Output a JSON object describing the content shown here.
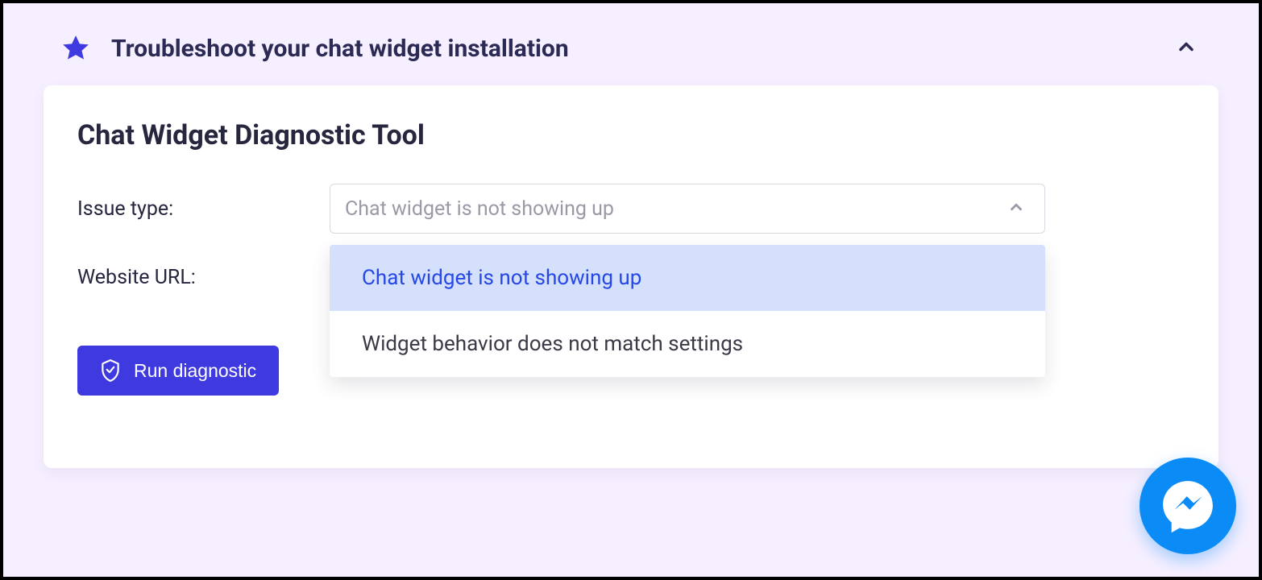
{
  "header": {
    "title": "Troubleshoot your chat widget installation"
  },
  "card": {
    "title": "Chat Widget Diagnostic Tool",
    "issue_label": "Issue type:",
    "url_label": "Website URL:",
    "select_value": "Chat widget is not showing up",
    "options": [
      "Chat widget is not showing up",
      "Widget behavior does not match settings"
    ],
    "run_label": "Run diagnostic"
  }
}
